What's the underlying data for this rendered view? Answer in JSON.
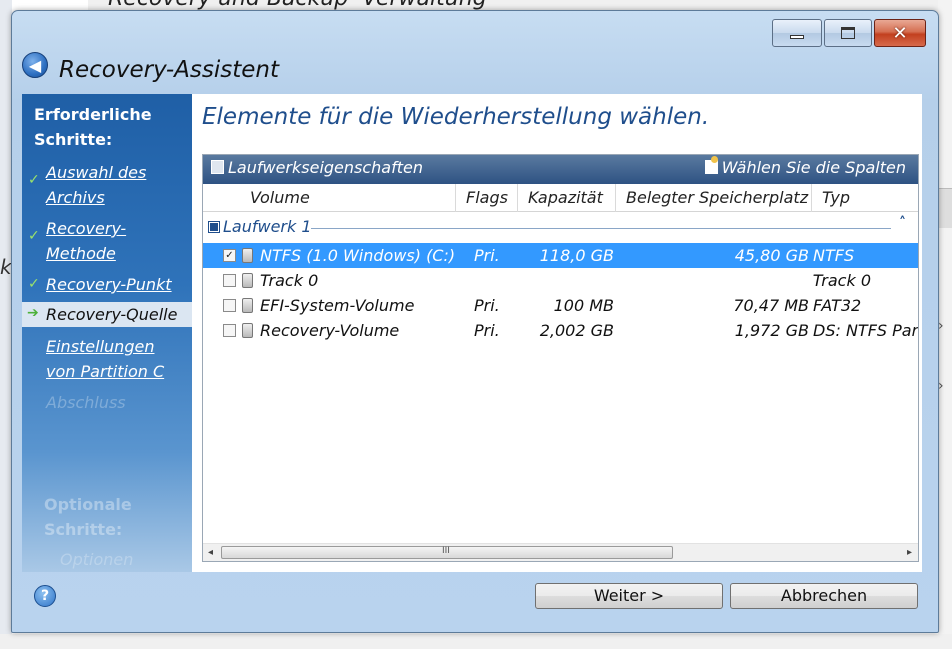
{
  "background_app": {
    "title_fragment": "Recovery und Backup -Verwaltung",
    "left_fragment": "k"
  },
  "window": {
    "title": "Recovery-Assistent",
    "controls": {
      "minimize": "minimize-icon",
      "maximize": "maximize-icon",
      "close": "close-icon"
    }
  },
  "steps": {
    "heading": "Erforderliche Schritte:",
    "items": [
      {
        "label": "Auswahl des Archivs",
        "state": "done"
      },
      {
        "label": "Recovery-Methode",
        "state": "done"
      },
      {
        "label": "Recovery-Punkt",
        "state": "done"
      },
      {
        "label": "Recovery-Quelle",
        "state": "current"
      },
      {
        "label": "Einstellungen von Partition C",
        "state": "pending"
      },
      {
        "label": "Abschluss",
        "state": "disabled"
      }
    ],
    "optional_heading": "Optionale Schritte:",
    "optional_item": "Optionen"
  },
  "main": {
    "heading": "Elemente für die Wiederherstellung wählen.",
    "toolbar": {
      "drive_properties": "Laufwerkseigenschaften",
      "choose_columns": "Wählen Sie die Spalten"
    },
    "columns": [
      "Volume",
      "Flags",
      "Kapazität",
      "Belegter Speicherplatz",
      "Typ"
    ],
    "group": {
      "label": "Laufwerk 1",
      "collapse_glyph": "˄"
    },
    "rows": [
      {
        "name": "NTFS (1.0 Windows) (C:)",
        "flags": "Pri.",
        "capacity": "118,0 GB",
        "used": "45,80 GB",
        "type": "NTFS",
        "checked": true,
        "selected": true
      },
      {
        "name": "Track 0",
        "flags": "",
        "capacity": "",
        "used": "",
        "type": "Track 0",
        "checked": false,
        "selected": false
      },
      {
        "name": "EFI-System-Volume",
        "flags": "Pri.",
        "capacity": "100 MB",
        "used": "70,47 MB",
        "type": "FAT32",
        "checked": false,
        "selected": false
      },
      {
        "name": "Recovery-Volume",
        "flags": "Pri.",
        "capacity": "2,002 GB",
        "used": "1,972 GB",
        "type": "DS: NTFS Par",
        "checked": false,
        "selected": false
      }
    ],
    "scrollbar": {
      "grip": "III"
    }
  },
  "footer": {
    "help_glyph": "?",
    "next_label": "Weiter >",
    "cancel_label": "Abbrechen"
  }
}
